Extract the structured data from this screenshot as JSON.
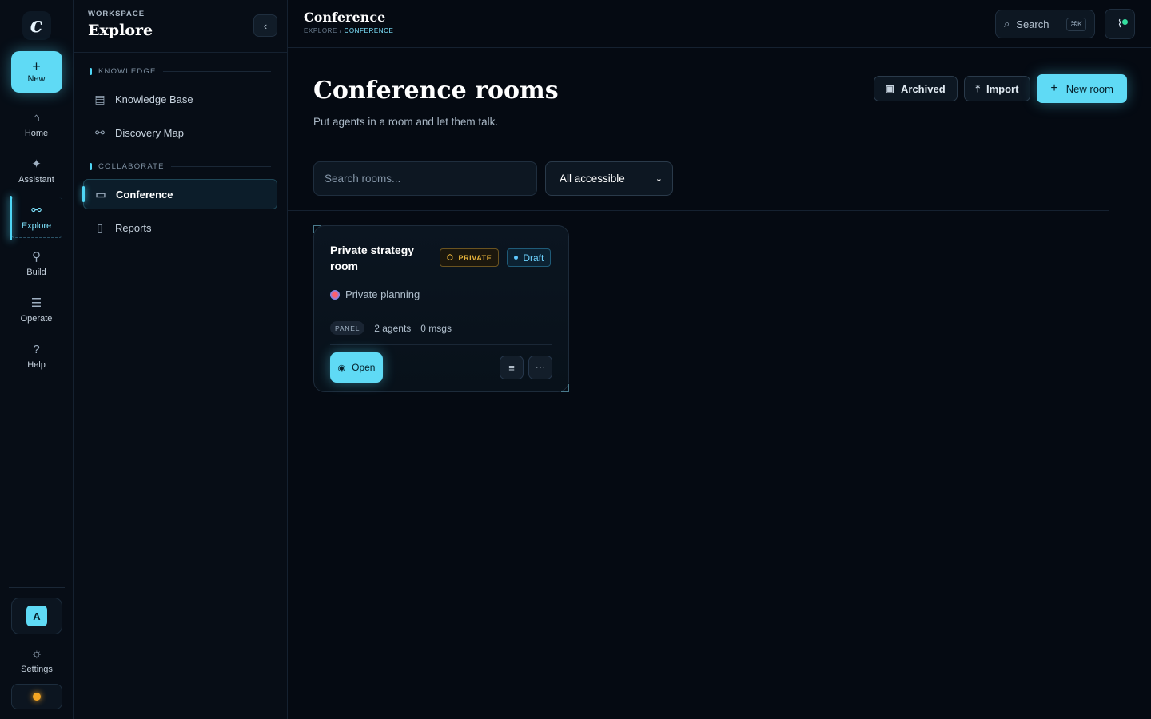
{
  "rail": {
    "logo": "c",
    "new_label": "New",
    "items": [
      {
        "label": "Home",
        "icon": "⌂"
      },
      {
        "label": "Assistant",
        "icon": "✦"
      },
      {
        "label": "Explore",
        "icon": "⚯"
      },
      {
        "label": "Build",
        "icon": "⚲"
      },
      {
        "label": "Operate",
        "icon": "☰"
      },
      {
        "label": "Help",
        "icon": "?"
      }
    ],
    "avatar": "A",
    "settings_label": "Settings",
    "theme_color": "#f5a623"
  },
  "panel": {
    "workspace_label": "WORKSPACE",
    "title": "Explore",
    "sections": [
      {
        "title": "KNOWLEDGE",
        "items": [
          {
            "label": "Knowledge Base",
            "icon": "▤"
          },
          {
            "label": "Discovery Map",
            "icon": "⚯"
          }
        ]
      },
      {
        "title": "COLLABORATE",
        "items": [
          {
            "label": "Conference",
            "icon": "▭"
          },
          {
            "label": "Reports",
            "icon": "▯"
          }
        ]
      }
    ]
  },
  "topbar": {
    "title": "Conference",
    "crumb_parent": "EXPLORE",
    "crumb_current": "CONFERENCE",
    "search_label": "Search",
    "search_kbd": "⌘K"
  },
  "page": {
    "title": "Conference rooms",
    "subtitle": "Put agents in a room and let them talk.",
    "archived_label": "Archived",
    "import_label": "Import",
    "new_room_label": "New room"
  },
  "filters": {
    "search_placeholder": "Search rooms...",
    "select_value": "All accessible"
  },
  "rooms": [
    {
      "title": "Private strategy room",
      "visibility": "PRIVATE",
      "status": "Draft",
      "category": "Private planning",
      "mode": "PANEL",
      "agents": "2 agents",
      "messages": "0 msgs",
      "open_label": "Open"
    }
  ],
  "colors": {
    "accent": "#5fdaf5",
    "background": "#050a12",
    "private": "#e8b43c",
    "draft": "#6ed4ff"
  }
}
